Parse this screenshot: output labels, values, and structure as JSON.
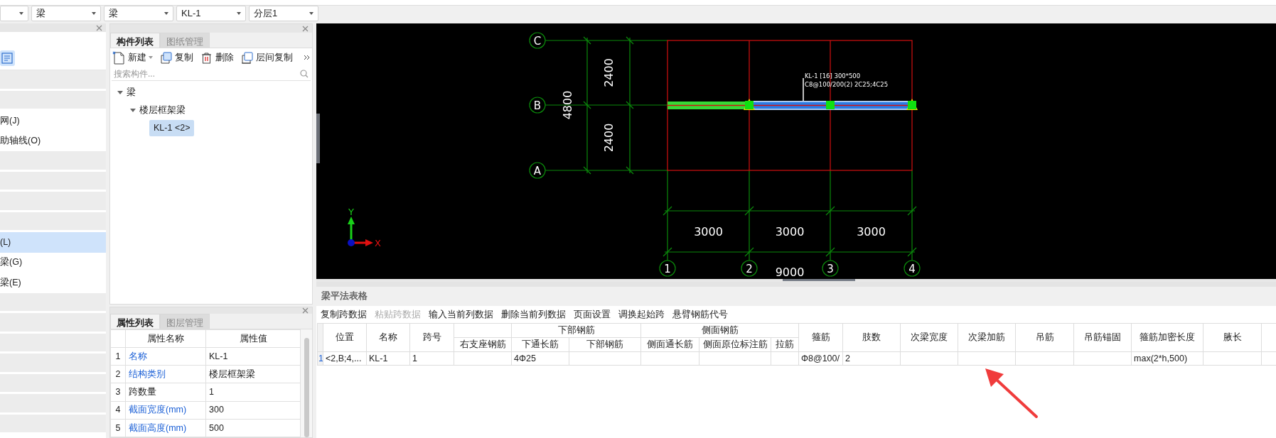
{
  "dropdowns": [
    {
      "kind": "blank"
    },
    {
      "kind": "value",
      "value": "梁"
    },
    {
      "kind": "value",
      "value": "梁"
    },
    {
      "kind": "value",
      "value": "KL-1"
    },
    {
      "kind": "value",
      "value": "分层1"
    }
  ],
  "left_panel": {
    "items": [
      {
        "kind": "group"
      },
      {
        "kind": "group"
      },
      {
        "kind": "item",
        "label": "网(J)",
        "selected": false
      },
      {
        "kind": "item",
        "label": "助轴线(O)",
        "selected": false
      },
      {
        "kind": "group"
      },
      {
        "kind": "group"
      },
      {
        "kind": "group"
      },
      {
        "kind": "group"
      },
      {
        "kind": "item",
        "label": "(L)",
        "selected": true
      },
      {
        "kind": "item",
        "label": "梁(G)",
        "selected": false
      },
      {
        "kind": "item",
        "label": "梁(E)",
        "selected": false
      },
      {
        "kind": "group"
      },
      {
        "kind": "group"
      },
      {
        "kind": "group"
      },
      {
        "kind": "group"
      },
      {
        "kind": "group"
      },
      {
        "kind": "group"
      },
      {
        "kind": "group"
      }
    ]
  },
  "component_panel": {
    "tabs": [
      {
        "label": "构件列表",
        "selected": true
      },
      {
        "label": "图纸管理",
        "selected": false
      }
    ],
    "toolbar": [
      {
        "label": "新建",
        "has_menu": true
      },
      {
        "label": "复制",
        "has_menu": false
      },
      {
        "label": "删除",
        "has_menu": false
      },
      {
        "label": "层间复制",
        "has_menu": false
      }
    ],
    "search": {
      "placeholder": "搜索构件..."
    },
    "tree": [
      {
        "label": "梁",
        "expanded": true,
        "children": [
          {
            "label": "楼层框架梁",
            "expanded": true,
            "children": [
              {
                "label": "KL-1 <2>",
                "selected": true
              }
            ]
          }
        ]
      }
    ]
  },
  "property_panel": {
    "tabs": [
      {
        "label": "属性列表",
        "selected": true
      },
      {
        "label": "图层管理",
        "selected": false
      }
    ],
    "columns": [
      "属性名称",
      "属性值"
    ],
    "rows": [
      {
        "index": "1",
        "name": "名称",
        "value": "KL-1",
        "highlighted": true
      },
      {
        "index": "2",
        "name": "结构类别",
        "value": "楼层框架梁",
        "highlighted": true
      },
      {
        "index": "3",
        "name": "跨数量",
        "value": "1",
        "highlighted": false
      },
      {
        "index": "4",
        "name": "截面宽度(mm)",
        "value": "300",
        "highlighted": true
      },
      {
        "index": "5",
        "name": "截面高度(mm)",
        "value": "500",
        "highlighted": true
      }
    ]
  },
  "canvas": {
    "row_axes": [
      "C",
      "B",
      "A"
    ],
    "column_axes": [
      "1",
      "2",
      "3",
      "4"
    ],
    "row_dimensions": [
      "2400",
      "2400"
    ],
    "row_total": "4800",
    "column_dimensions": [
      "3000",
      "3000",
      "3000"
    ],
    "column_total": "9000",
    "beam_annotation": [
      "KL-1 [16] 300*500",
      "C8@100/200(2) 2C25;4C25"
    ],
    "axis_letters": {
      "x": "X",
      "y": "Y"
    }
  },
  "table_panel": {
    "title": "梁平法表格",
    "column_groups": [
      {
        "kind": "blank"
      },
      {
        "kind": "label",
        "label": "下部钢筋"
      },
      {
        "kind": "label",
        "label": "侧面钢筋"
      }
    ],
    "actions": [
      {
        "label": "复制跨数据",
        "disabled": false
      },
      {
        "label": "粘贴跨数据",
        "disabled": true
      },
      {
        "label": "输入当前列数据",
        "disabled": false
      },
      {
        "label": "删除当前列数据",
        "disabled": false
      },
      {
        "label": "页面设置",
        "disabled": false
      },
      {
        "label": "调换起始跨",
        "disabled": false
      },
      {
        "label": "悬臂钢筋代号",
        "disabled": false
      }
    ],
    "columns": [
      {
        "kind": "single",
        "label": "位置"
      },
      {
        "kind": "single",
        "label": "名称"
      },
      {
        "kind": "single",
        "label": "跨号"
      },
      {
        "kind": "group_start",
        "label": "右支座钢筋"
      },
      {
        "kind": "group_start",
        "label": "下通长筋"
      },
      {
        "kind": "group_rest",
        "label": "下部钢筋"
      },
      {
        "kind": "group_start",
        "label": "侧面通长筋"
      },
      {
        "kind": "group_rest",
        "label": "侧面原位标注筋"
      },
      {
        "kind": "group_rest",
        "label": "拉筋"
      },
      {
        "kind": "single",
        "label": "箍筋"
      },
      {
        "kind": "single",
        "label": "肢数"
      },
      {
        "kind": "single",
        "label": "次梁宽度"
      },
      {
        "kind": "single",
        "label": "次梁加筋"
      },
      {
        "kind": "single",
        "label": "吊筋"
      },
      {
        "kind": "single",
        "label": "吊筋锚固"
      },
      {
        "kind": "single",
        "label": "箍筋加密长度"
      },
      {
        "kind": "single",
        "label": "腋长"
      }
    ],
    "rows": [
      {
        "index": "1",
        "cells": [
          "<2,B;4,...",
          "KL-1",
          "1",
          "",
          "4Φ25",
          "",
          "",
          "",
          "",
          "Φ8@100/",
          "2",
          "",
          "",
          "",
          "",
          "max(2*h,500)",
          ""
        ]
      }
    ]
  }
}
